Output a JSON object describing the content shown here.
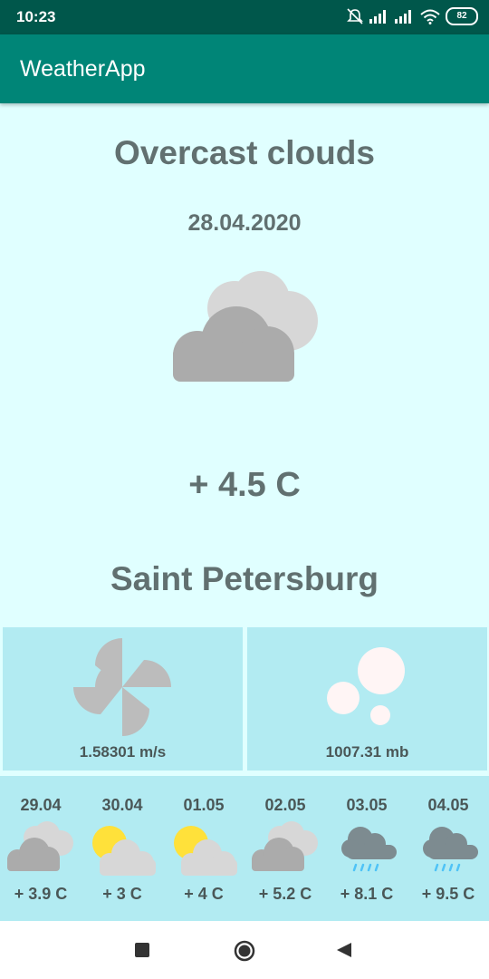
{
  "status": {
    "time": "10:23",
    "battery": "82"
  },
  "app": {
    "title": "WeatherApp"
  },
  "weather": {
    "condition": "Overcast clouds",
    "date": "28.04.2020",
    "temperature": "+ 4.5 C",
    "city": "Saint Petersburg",
    "wind": "1.58301 m/s",
    "pressure": "1007.31 mb",
    "icon": "overcast-clouds-icon"
  },
  "forecast": [
    {
      "date": "29.04",
      "temp": "+ 3.9 C",
      "icon": "overcast-clouds-icon"
    },
    {
      "date": "30.04",
      "temp": "+ 3 C",
      "icon": "partly-cloudy-icon"
    },
    {
      "date": "01.05",
      "temp": "+ 4 C",
      "icon": "partly-cloudy-icon"
    },
    {
      "date": "02.05",
      "temp": "+ 5.2 C",
      "icon": "overcast-clouds-icon"
    },
    {
      "date": "03.05",
      "temp": "+ 8.1 C",
      "icon": "rain-icon"
    },
    {
      "date": "04.05",
      "temp": "+ 9.5 C",
      "icon": "rain-icon"
    }
  ],
  "colors": {
    "status_bar": "#00574b",
    "app_bar": "#008577",
    "background": "#e0ffff",
    "card": "#b2ebf2"
  }
}
